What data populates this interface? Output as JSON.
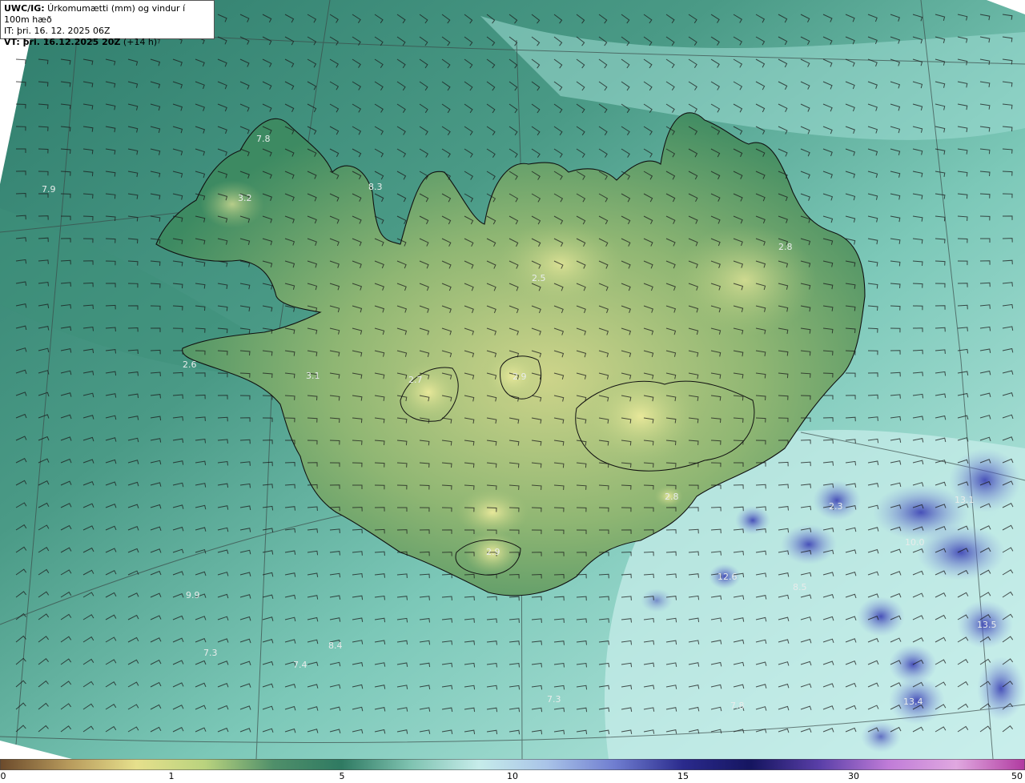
{
  "header": {
    "model_label": "UWC/IG:",
    "title_text": " Úrkomumætti (mm) og vindur í 100m hæð",
    "init_line": "IT: þri. 16. 12. 2025 06Z",
    "valid_label": "VT: þri. 16.12.2025 20Z",
    "valid_suffix": " (+14 h)"
  },
  "map_labels": [
    {
      "text": "7.9"
    },
    {
      "text": "7.8"
    },
    {
      "text": "3.2"
    },
    {
      "text": "8.3"
    },
    {
      "text": "2.8"
    },
    {
      "text": "2.5"
    },
    {
      "text": "2.6"
    },
    {
      "text": "3.1"
    },
    {
      "text": "2.7"
    },
    {
      "text": "2.8"
    },
    {
      "text": "2.9"
    },
    {
      "text": "2.9"
    },
    {
      "text": "2.3"
    },
    {
      "text": "13.1"
    },
    {
      "text": "10.0"
    },
    {
      "text": "12.6"
    },
    {
      "text": "8.5"
    },
    {
      "text": "13.5"
    },
    {
      "text": "9.9"
    },
    {
      "text": "7.3"
    },
    {
      "text": "7.4"
    },
    {
      "text": "8.4"
    },
    {
      "text": "7.3"
    },
    {
      "text": "7.8"
    },
    {
      "text": "13.4"
    }
  ],
  "colorbar": {
    "ticks": [
      "0",
      "1",
      "5",
      "10",
      "15",
      "30",
      "50"
    ],
    "colors": [
      "#6b4a2b",
      "#b79a5c",
      "#e6e08c",
      "#b9d37e",
      "#4f8f6a",
      "#2f7a62",
      "#7ec2b0",
      "#c6ecea",
      "#a9c4e8",
      "#6f7dd0",
      "#2a2a8c",
      "#151560",
      "#5a3fa8",
      "#c07cd8",
      "#e0a8e0",
      "#b03aa0"
    ]
  },
  "colors": {
    "sea_dark": "#2f7d6c",
    "sea_mid": "#5aa797",
    "sea_light": "#aee6e0",
    "land_low": "#3f8a5f",
    "land_high": "#d9d890",
    "precip_heavy": "#3b3fb0"
  }
}
